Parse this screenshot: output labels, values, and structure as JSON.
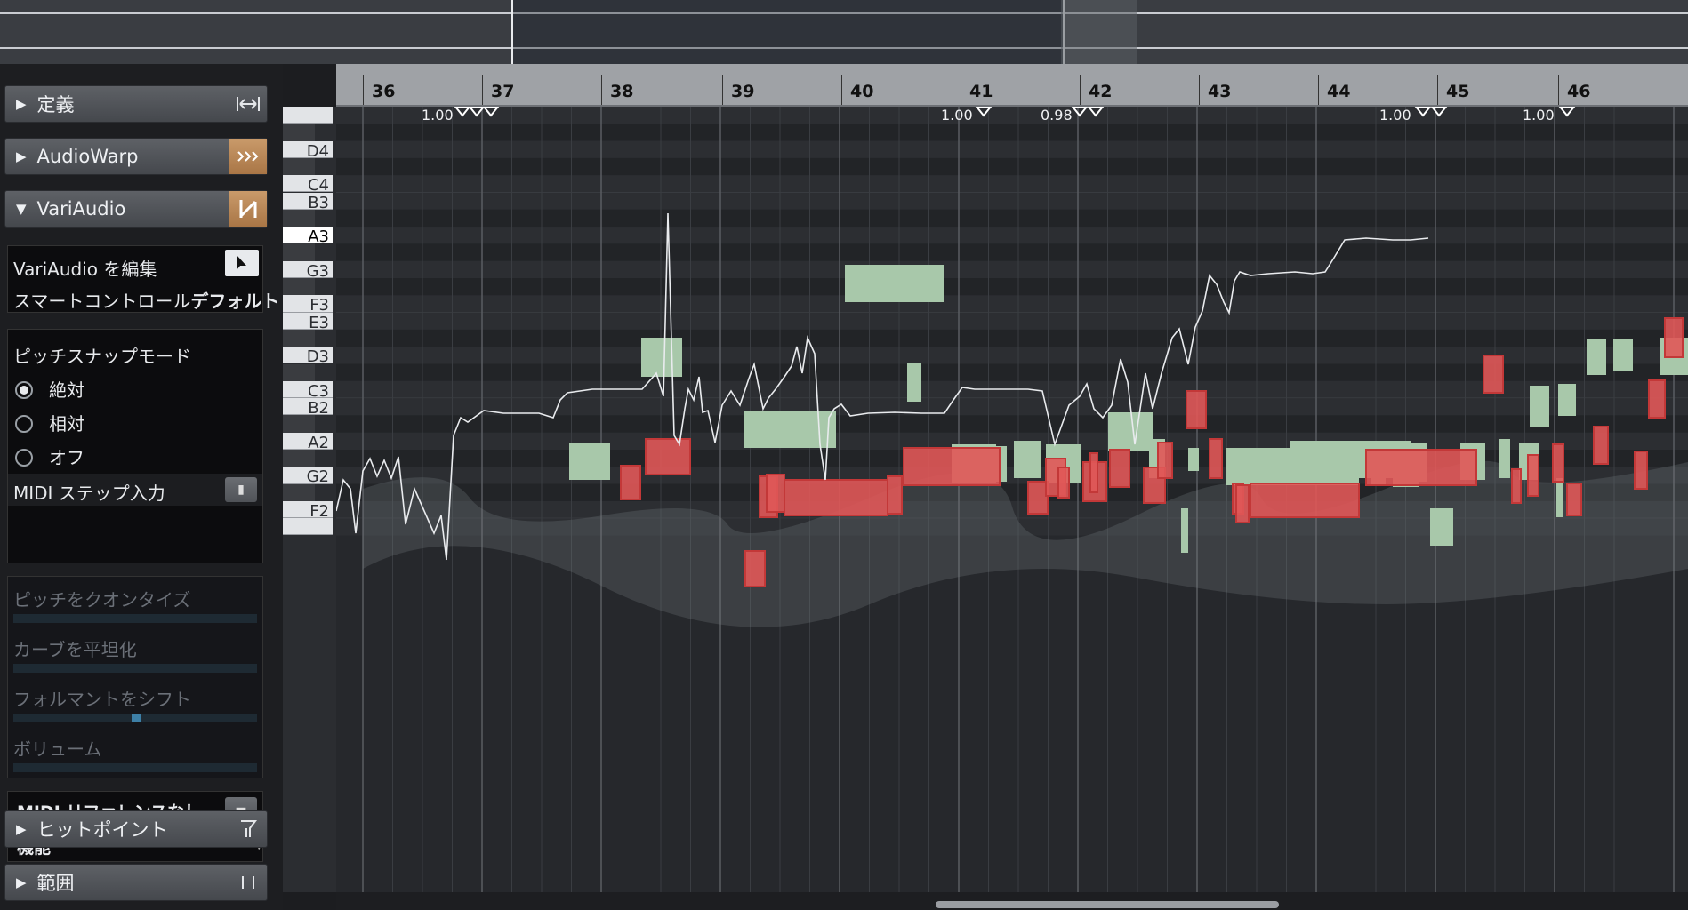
{
  "inspector": {
    "sections": {
      "definition": "定義",
      "audiowarp": "AudioWarp",
      "variaudio": "VariAudio",
      "hitpoint": "ヒットポイント",
      "range": "範囲"
    },
    "variaudio_panel": {
      "edit_label": "VariAudio を編集",
      "smart_control_label": "スマートコントロール",
      "smart_control_value": "デフォルト",
      "pitch_snap_title": "ピッチスナップモード",
      "snap_modes": [
        "絶対",
        "相対",
        "オフ"
      ],
      "snap_selected": 0,
      "midi_step_label": "MIDI ステップ入力"
    },
    "functions_panel": {
      "items": [
        "ピッチをクオンタイズ",
        "カーブを平坦化",
        "フォルマントをシフト",
        "ボリューム"
      ]
    },
    "midi_ref": {
      "label": "MIDI リファレンスなし",
      "function_label": "機能"
    }
  },
  "ruler": {
    "bars": [
      "36",
      "37",
      "38",
      "39",
      "40",
      "41",
      "42",
      "43",
      "44",
      "45",
      "46"
    ],
    "warp_markers": [
      "1.00",
      "1.00",
      "0.98",
      "1.00",
      "1.00"
    ]
  },
  "keyboard": {
    "labels": [
      "D4",
      "C4",
      "B3",
      "A3",
      "G3",
      "F3",
      "E3",
      "D3",
      "C3",
      "B2",
      "A2",
      "G2",
      "F2"
    ],
    "selected": "A3"
  },
  "colors": {
    "segment_fill": "#e05858",
    "segment_border": "#c33838",
    "midi_ref_fill": "#a8c8aa",
    "accent_orange": "#b88457"
  },
  "icons": {
    "definition_button": "fit-width-icon",
    "audiowarp_button": "warp-arrows-icon",
    "variaudio_button": "variaudio-icon",
    "edit_tool": "pointer-icon",
    "hitpoint_button": "filter-icon",
    "range_button": "range-bars-icon"
  }
}
